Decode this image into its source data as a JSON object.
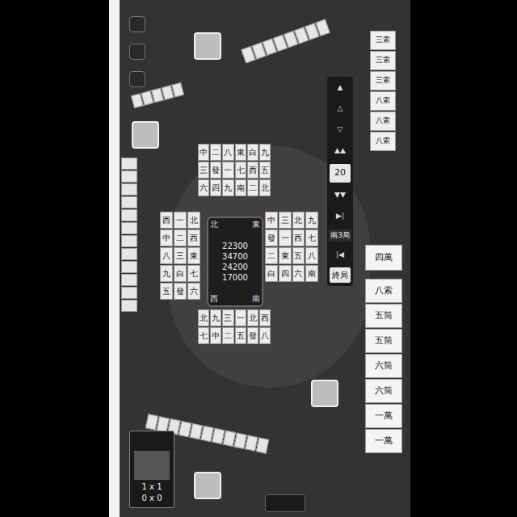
{
  "round": "南3局",
  "turn_count": "20",
  "end_button": "終局",
  "controls": [
    "▲",
    "△",
    "▽",
    "▲▲",
    "▼▼",
    "▶|",
    "|◀"
  ],
  "scores": [
    {
      "seat": "top",
      "value": "22300"
    },
    {
      "seat": "left",
      "value": "34700"
    },
    {
      "seat": "center",
      "value": "24200"
    },
    {
      "seat": "right",
      "value": "17000"
    }
  ],
  "winds": [
    "北",
    "東",
    "西",
    "南"
  ],
  "discards": [
    {
      "seat": "top",
      "tiles": [
        "中",
        "二",
        "八",
        "東",
        "白",
        "九",
        "三",
        "發",
        "一",
        "七",
        "西",
        "五",
        "六",
        "四",
        "九",
        "南",
        "二",
        "北"
      ]
    },
    {
      "seat": "left",
      "tiles": [
        "西",
        "一",
        "北",
        "中",
        "二",
        "西",
        "八",
        "三",
        "東",
        "九",
        "白",
        "七",
        "五",
        "發",
        "六"
      ]
    },
    {
      "seat": "right",
      "tiles": [
        "中",
        "三",
        "北",
        "九",
        "發",
        "一",
        "西",
        "七",
        "二",
        "東",
        "五",
        "八",
        "白",
        "四",
        "六",
        "南"
      ]
    },
    {
      "seat": "bottom",
      "tiles": [
        "北",
        "九",
        "三",
        "一",
        "北",
        "西",
        "七",
        "中",
        "二",
        "五",
        "發",
        "八"
      ]
    }
  ],
  "meld": [
    "三索",
    "三索",
    "三索",
    "八索",
    "八索",
    "八索"
  ],
  "drawn_tile": "四萬",
  "hand": [
    "八索",
    "五筒",
    "五筒",
    "六筒",
    "六筒",
    "一萬",
    "一萬"
  ],
  "record": [
    "1 x 1",
    "0 x 0"
  ]
}
